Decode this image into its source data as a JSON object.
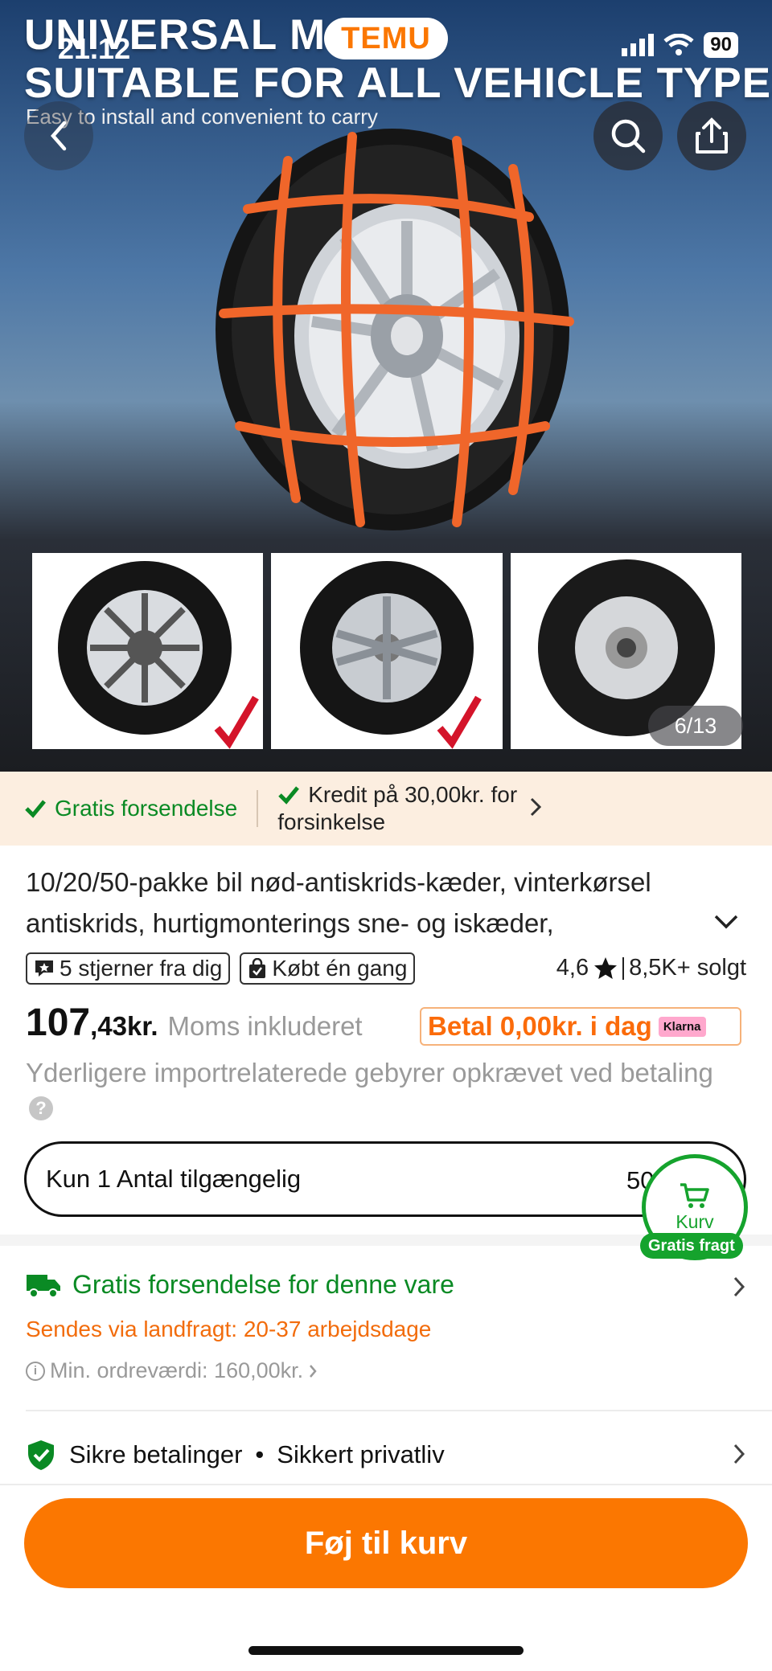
{
  "status_bar": {
    "time": "21.12",
    "battery": "90"
  },
  "app": {
    "logo": "TEMU"
  },
  "hero": {
    "headline_line1": "UNIVERSAL MODEL",
    "headline_line2": "SUITABLE FOR ALL VEHICLE TYPES",
    "subline": "Easy to install and convenient to carry",
    "image_counter": "6/13"
  },
  "icons": {
    "back": "chevron-left-icon",
    "search": "search-icon",
    "share": "share-icon",
    "check": "check-icon",
    "chevron_right": "chevron-right-icon",
    "chevron_down": "chevron-down-icon",
    "truck": "truck-icon",
    "shield": "shield-check-icon",
    "cart": "cart-icon",
    "star": "star-icon",
    "info": "info-icon"
  },
  "benefits": {
    "free_shipping": "Gratis forsendelse",
    "credit_line1": "Kredit på 30,00kr. for",
    "credit_line2": "forsinkelse"
  },
  "product": {
    "title": "10/20/50-pakke bil nød-antiskrids-kæder, vinterkørsel antiskrids, hurtigmonterings sne- og iskæder,",
    "badge_stars": "5 stjerner fra dig",
    "badge_bought": "Købt én gang",
    "rating": "4,6",
    "sold": "8,5K+ solgt",
    "price_int": "107",
    "price_dec": ",43kr.",
    "vat_note": "Moms inkluderet",
    "klarna_text": "Betal 0,00kr. i dag",
    "klarna_logo": "Klarna",
    "import_note": "Yderligere importrelaterede gebyrer opkrævet ved betaling"
  },
  "quantity": {
    "label": "Kun 1 Antal tilgængelig",
    "value": "50"
  },
  "floating_cart": {
    "label": "Kurv",
    "pill": "Gratis fragt"
  },
  "shipping": {
    "title": "Gratis forsendelse for denne vare",
    "eta": "Sendes via landfragt: 20-37 arbejdsdage",
    "min_order": "Min. ordreværdi: 160,00kr."
  },
  "security": {
    "payments": "Sikre betalinger",
    "separator": "•",
    "privacy": "Sikkert privatliv"
  },
  "cta": {
    "label": "Føj til kurv"
  },
  "colors": {
    "brand": "#fb7701",
    "green": "#0a8a24",
    "klarna": "#ffa8cd"
  }
}
